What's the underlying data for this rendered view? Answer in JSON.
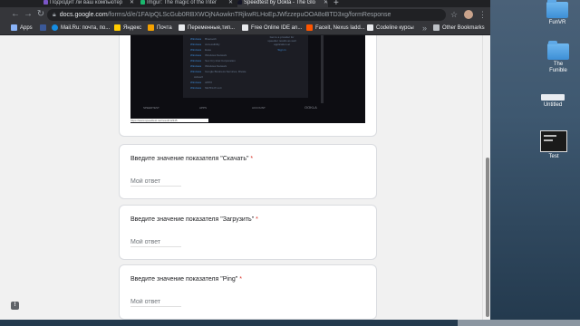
{
  "browser": {
    "tabs": [
      {
        "label": "Подходит ли ваш компьютер",
        "color": "#7b56c8"
      },
      {
        "label": "Imgur: The magic of the Inter",
        "color": "#1bb76e"
      },
      {
        "label": "Speedtest by Ookla - The Glo",
        "color": "#141526"
      }
    ],
    "new_tab": "+",
    "url_host": "docs.google.com",
    "url_path": "/forms/d/e/1FAIpQLScGub0RBXWOjNAowknTRjkwRLHoEpJWfzzepuOOA8oBTD3xg/formResponse",
    "bookmarks": [
      {
        "label": "Apps",
        "color": "#8ab4f8"
      },
      {
        "label": "",
        "color": "#3b5998"
      },
      {
        "label": "Mail.Ru: почта, по...",
        "color": "#168de2"
      },
      {
        "label": "Яндекс",
        "color": "#ffcc00"
      },
      {
        "label": "Почта",
        "color": "#f4a100"
      },
      {
        "label": "Переменные,тип...",
        "color": "#e8eaed"
      },
      {
        "label": "Free Online IDE an...",
        "color": "#e8eaed"
      },
      {
        "label": "Faceit, Nexus ladd...",
        "color": "#ff5500"
      },
      {
        "label": "Codeline курсы",
        "color": "#e8eaed"
      }
    ],
    "other_bookmarks": "Other Bookmarks"
  },
  "screenshot": {
    "rows": [
      {
        "tag": "Windows",
        "text": "Bluetooth"
      },
      {
        "tag": "Windows",
        "text": "Accessibility"
      },
      {
        "tag": "Windows",
        "text": "Ease"
      },
      {
        "tag": "Windows",
        "text": "Windows Network"
      },
      {
        "tag": "Windows",
        "text": "Sec Cry Intel Corporation"
      },
      {
        "tag": "Windows",
        "text": "Windows Network"
      },
      {
        "tag": "Windows",
        "text": "Google Business Services, Rivate"
      },
      {
        "tag": "",
        "text": "ActiveX"
      },
      {
        "tag": "Windows",
        "text": "APPX"
      },
      {
        "tag": "Windows",
        "text": "NETFLIX LLC"
      }
    ],
    "side_lines": [
      "Get to a provider for",
      "speedier results as well",
      "application at"
    ],
    "side_link": "Sign in",
    "footer": [
      "SPEEDTEST",
      "APPS",
      "ACCOUNT",
      "OOKLA"
    ],
    "caption": "https://www.speedtest.net/result/12345"
  },
  "form": {
    "questions": [
      {
        "title": "Введите значение показателя \"Скачать\"",
        "required": "*",
        "placeholder": "Мой ответ"
      },
      {
        "title": "Введите значение показателя \"Загрузить\"",
        "required": "*",
        "placeholder": "Мой ответ"
      },
      {
        "title": "Введите значение показателя \"Ping\"",
        "required": "*",
        "placeholder": "Мой ответ"
      }
    ],
    "feedback_icon": "!"
  },
  "desktop": {
    "icons": [
      {
        "label": "FunVR",
        "kind": "folder-icon"
      },
      {
        "label": "The Funible",
        "kind": "folder-icon"
      },
      {
        "label": "Untitled",
        "kind": "document-icon"
      },
      {
        "label": "Test",
        "kind": "screenshot-icon"
      }
    ]
  }
}
